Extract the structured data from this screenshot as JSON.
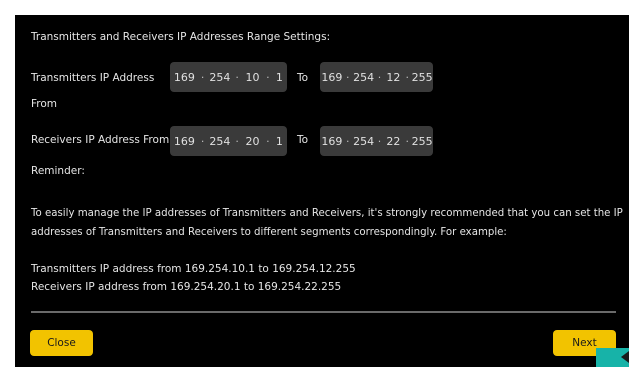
{
  "dialog": {
    "heading": "Transmitters and Receivers IP Addresses Range Settings:",
    "transmitters": {
      "label_line1": "Transmitters IP Address",
      "label_line2": "From",
      "from": [
        "169",
        "254",
        "10",
        "1"
      ],
      "to_label": "To",
      "to": [
        "169",
        "254",
        "12",
        "255"
      ]
    },
    "receivers": {
      "label": "Receivers IP Address From",
      "from": [
        "169",
        "254",
        "20",
        "1"
      ],
      "to_label": "To",
      "to": [
        "169",
        "254",
        "22",
        "255"
      ]
    },
    "reminder_title": "Reminder:",
    "reminder_line1": "To easily manage the IP addresses of Transmitters and Receivers, it's strongly recommended that you can set the IP",
    "reminder_line2": "addresses of Transmitters and Receivers to different segments correspondingly. For example:",
    "example_tx": "Transmitters IP address from 169.254.10.1 to 169.254.12.255",
    "example_rx": "Receivers IP address from 169.254.20.1 to 169.254.22.255",
    "buttons": {
      "close": "Close",
      "next": "Next"
    }
  },
  "colors": {
    "accent": "#f2c300",
    "corner": "#17b3a8",
    "field_bg": "#3a3a3a"
  },
  "icons": {
    "corner": "collapse-arrow-icon"
  }
}
